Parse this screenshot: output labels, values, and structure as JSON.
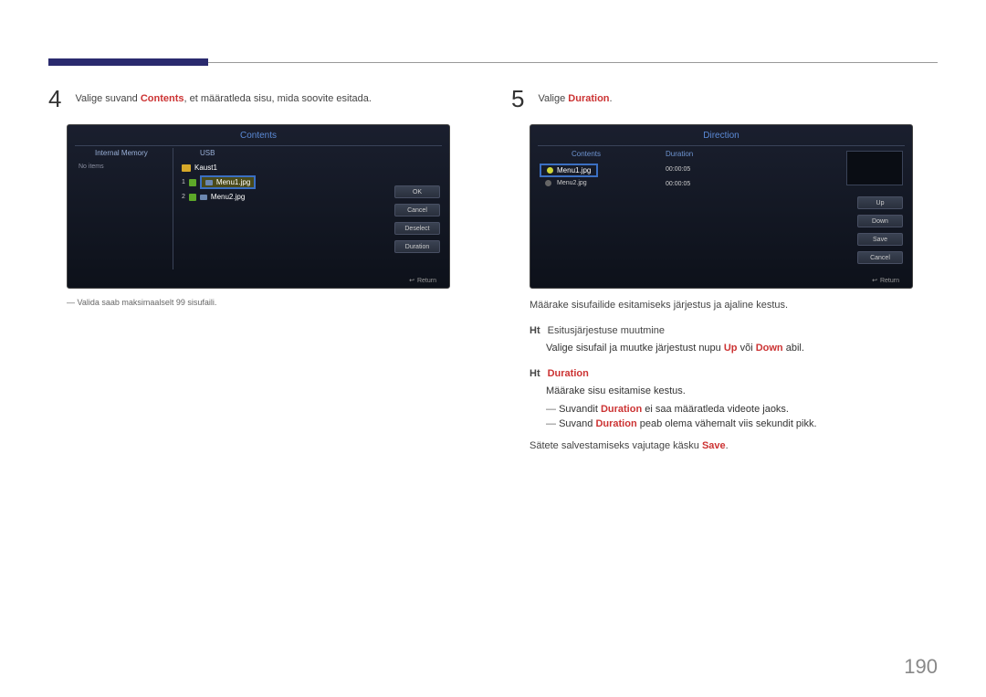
{
  "page_number": "190",
  "left": {
    "step_number": "4",
    "step_text_before": "Valige suvand ",
    "step_text_hl": "Contents",
    "step_text_after": ", et määratleda sisu, mida soovite esitada.",
    "screenshot": {
      "title": "Contents",
      "col_left": "Internal Memory",
      "col_right": "USB",
      "no_items": "No items",
      "kaust": "Kaust1",
      "item1_num": "1",
      "item1_name": "Menu1.jpg",
      "item2_num": "2",
      "item2_name": "Menu2.jpg",
      "btn_ok": "OK",
      "btn_cancel": "Cancel",
      "btn_deselect": "Deselect",
      "btn_duration": "Duration",
      "return": "Return"
    },
    "note": "Valida saab maksimaalselt 99 sisufaili."
  },
  "right": {
    "step_number": "5",
    "step_text_before": "Valige ",
    "step_text_hl": "Duration",
    "step_text_after": ".",
    "screenshot": {
      "title": "Direction",
      "col1": "Contents",
      "col2": "Duration",
      "item1": "Menu1.jpg",
      "dur1": "00:00:05",
      "item2": "Menu2.jpg",
      "dur2": "00:00:05",
      "btn_up": "Up",
      "btn_down": "Down",
      "btn_save": "Save",
      "btn_cancel": "Cancel",
      "return": "Return"
    },
    "desc1": "Määrake sisufailide esitamiseks järjestus ja ajaline kestus.",
    "sub1_tag": "Ht",
    "sub1_title": "Esitusjärjestuse muutmine",
    "sub1_line_a": "Valige sisufail ja muutke järjestust nupu ",
    "sub1_line_hl1": "Up",
    "sub1_line_mid": " või ",
    "sub1_line_hl2": "Down",
    "sub1_line_b": " abil.",
    "sub2_tag": "Ht",
    "sub2_title": "Duration",
    "sub2_desc": "Määrake sisu esitamise kestus.",
    "sub2_note1_a": "Suvandit ",
    "sub2_note1_hl": "Duration",
    "sub2_note1_b": " ei saa määratleda videote jaoks.",
    "sub2_note2_a": "Suvand ",
    "sub2_note2_hl": "Duration",
    "sub2_note2_b": " peab olema vähemalt viis sekundit pikk.",
    "desc2_a": "Sätete salvestamiseks vajutage käsku ",
    "desc2_hl": "Save",
    "desc2_b": "."
  }
}
